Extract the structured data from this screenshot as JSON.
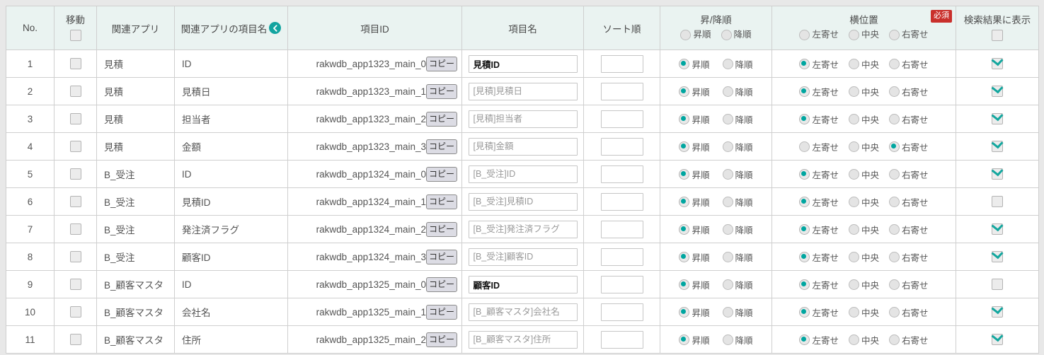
{
  "header": {
    "columns": {
      "no": "No.",
      "move": "移動",
      "related_app": "関連アプリ",
      "related_app_field": "関連アプリの項目名",
      "sort_toggle_icon": "chevron-left-circle-icon",
      "field_id": "項目ID",
      "field_name": "項目名",
      "sort_order": "ソート順",
      "order_direction": "昇/降順",
      "horizontal_position": "横位置",
      "show_in_results": "検索結果に表示"
    },
    "order_options": [
      "昇順",
      "降順"
    ],
    "position_options": [
      "左寄せ",
      "中央",
      "右寄せ"
    ],
    "required_badge": "必須",
    "move_all_checked": false,
    "show_all_checked": false
  },
  "buttons": {
    "copy_label": "コピー"
  },
  "colors": {
    "accent": "#00a6a0",
    "header_bg": "#eaf3f1",
    "required_badge": "#c9302c",
    "border": "#cfcfcf",
    "page_bg": "#e8e8e8"
  },
  "rows": [
    {
      "no": "1",
      "move_checked": false,
      "related_app": "見積",
      "related_app_field": "ID",
      "field_id": "rakwdb_app1323_main_0",
      "field_name_value": "見積ID",
      "field_name_placeholder": "",
      "sort_order_value": "",
      "order_direction": "昇順",
      "horizontal_position": "左寄せ",
      "show_in_results": true
    },
    {
      "no": "2",
      "move_checked": false,
      "related_app": "見積",
      "related_app_field": "見積日",
      "field_id": "rakwdb_app1323_main_1",
      "field_name_value": "",
      "field_name_placeholder": "[見積]見積日",
      "sort_order_value": "",
      "order_direction": "昇順",
      "horizontal_position": "左寄せ",
      "show_in_results": true
    },
    {
      "no": "3",
      "move_checked": false,
      "related_app": "見積",
      "related_app_field": "担当者",
      "field_id": "rakwdb_app1323_main_2",
      "field_name_value": "",
      "field_name_placeholder": "[見積]担当者",
      "sort_order_value": "",
      "order_direction": "昇順",
      "horizontal_position": "左寄せ",
      "show_in_results": true
    },
    {
      "no": "4",
      "move_checked": false,
      "related_app": "見積",
      "related_app_field": "金額",
      "field_id": "rakwdb_app1323_main_3",
      "field_name_value": "",
      "field_name_placeholder": "[見積]金額",
      "sort_order_value": "",
      "order_direction": "昇順",
      "horizontal_position": "右寄せ",
      "show_in_results": true
    },
    {
      "no": "5",
      "move_checked": false,
      "related_app": "B_受注",
      "related_app_field": "ID",
      "field_id": "rakwdb_app1324_main_0",
      "field_name_value": "",
      "field_name_placeholder": "[B_受注]ID",
      "sort_order_value": "",
      "order_direction": "昇順",
      "horizontal_position": "左寄せ",
      "show_in_results": true
    },
    {
      "no": "6",
      "move_checked": false,
      "related_app": "B_受注",
      "related_app_field": "見積ID",
      "field_id": "rakwdb_app1324_main_1",
      "field_name_value": "",
      "field_name_placeholder": "[B_受注]見積ID",
      "sort_order_value": "",
      "order_direction": "昇順",
      "horizontal_position": "左寄せ",
      "show_in_results": false
    },
    {
      "no": "7",
      "move_checked": false,
      "related_app": "B_受注",
      "related_app_field": "発注済フラグ",
      "field_id": "rakwdb_app1324_main_2",
      "field_name_value": "",
      "field_name_placeholder": "[B_受注]発注済フラグ",
      "sort_order_value": "",
      "order_direction": "昇順",
      "horizontal_position": "左寄せ",
      "show_in_results": true
    },
    {
      "no": "8",
      "move_checked": false,
      "related_app": "B_受注",
      "related_app_field": "顧客ID",
      "field_id": "rakwdb_app1324_main_3",
      "field_name_value": "",
      "field_name_placeholder": "[B_受注]顧客ID",
      "sort_order_value": "",
      "order_direction": "昇順",
      "horizontal_position": "左寄せ",
      "show_in_results": true
    },
    {
      "no": "9",
      "move_checked": false,
      "related_app": "B_顧客マスタ",
      "related_app_field": "ID",
      "field_id": "rakwdb_app1325_main_0",
      "field_name_value": "顧客ID",
      "field_name_placeholder": "",
      "sort_order_value": "",
      "order_direction": "昇順",
      "horizontal_position": "左寄せ",
      "show_in_results": false
    },
    {
      "no": "10",
      "move_checked": false,
      "related_app": "B_顧客マスタ",
      "related_app_field": "会社名",
      "field_id": "rakwdb_app1325_main_1",
      "field_name_value": "",
      "field_name_placeholder": "[B_顧客マスタ]会社名",
      "sort_order_value": "",
      "order_direction": "昇順",
      "horizontal_position": "左寄せ",
      "show_in_results": true
    },
    {
      "no": "11",
      "move_checked": false,
      "related_app": "B_顧客マスタ",
      "related_app_field": "住所",
      "field_id": "rakwdb_app1325_main_2",
      "field_name_value": "",
      "field_name_placeholder": "[B_顧客マスタ]住所",
      "sort_order_value": "",
      "order_direction": "昇順",
      "horizontal_position": "左寄せ",
      "show_in_results": true
    }
  ]
}
